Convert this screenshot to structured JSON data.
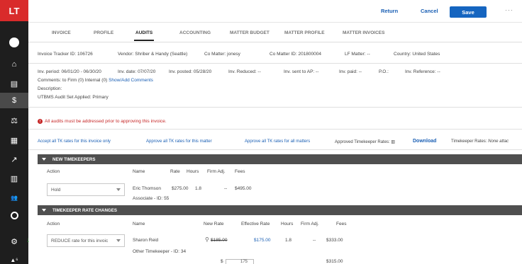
{
  "app": {
    "logo": "LT"
  },
  "nav": {
    "icons": [
      "user-avatar",
      "home-icon",
      "document-icon",
      "dollar-icon",
      "gavel-icon",
      "calendar-icon",
      "analytics-icon",
      "building-icon",
      "people-icon",
      "search-icon",
      "settings-icon",
      "alerts-icon"
    ],
    "avatar_glyph": "",
    "glyphs": {
      "home": "⌂",
      "document": "▤",
      "dollar": "$",
      "gavel": "⚖",
      "calendar": "▦",
      "analytics": "↗",
      "building": "▥",
      "people": "👥",
      "search": "○",
      "settings": "⚙",
      "alerts": "▲⁶"
    }
  },
  "toolbar": {
    "return_label": "Return",
    "cancel_label": "Cancel",
    "save_label": "Save",
    "more_label": "···"
  },
  "tabs": [
    "Invoice",
    "Profile",
    "Audits",
    "Accounting",
    "Matter Budget",
    "Matter Profile",
    "Matter Invoices"
  ],
  "active_tab": "Audits",
  "invoice_info": {
    "tracker_id": "Invoice Tracker ID: 106726",
    "vendor": "Vendor: Shriber & Handy (Seattle)",
    "co_matter": "Co Matter: jonesy",
    "co_matter_id": "Co Matter ID: 201800004",
    "lf_matter": "LF Matter: --",
    "country": "Country: United States"
  },
  "details": {
    "inv_period": "Inv. period: 06/01/20 - 06/30/20",
    "inv_date": "Inv. date: 07/07/20",
    "inv_posted": "Inv. posted: 05/28/20",
    "inv_reduced": "Inv. Reduced: --",
    "inv_sent": "Inv. sent to AP: --",
    "inv_paid": "Inv. paid: --",
    "po": "P.O.: ",
    "inv_reference": "Inv. Reference: --",
    "comments_prefix": "Comments: to Firm (0) Internal (0) ",
    "comments_link": "Show/Add Comments",
    "description": "Description:",
    "utbms": "UTBMS Audit Set Applied: Primary"
  },
  "alert_text": "All audits must be addressed prior to approving this invoice.",
  "alert_icon": "!",
  "actions": {
    "accept_invoice": "Accept all TK rates for this invoice only",
    "approve_matter": "Approve all TK rates for this matter",
    "approve_all": "Approve all TK rates for all matters",
    "approved_label": "Approved Timekeeper Rates: ▥",
    "download": "Download",
    "tk_rates": "Timekeeper Rates: ",
    "tk_rates_value": "None attac"
  },
  "new_timekeepers": {
    "title": "NEW TIMEKEEPERS",
    "headers": {
      "action": "Action",
      "name": "Name",
      "rate": "Rate",
      "hours": "Hours",
      "firm_adj": "Firm Adj.",
      "fees": "Fees"
    },
    "row": {
      "action_value": "Hold",
      "name": "Eric Thomson",
      "name_sub": "Associate - ID: 55",
      "rate": "$275.00",
      "hours": "1.8",
      "firm_adj": "--",
      "fees": "$495.00"
    }
  },
  "rate_changes": {
    "title": "TIMEKEEPER RATE CHANGES",
    "headers": {
      "action": "Action",
      "name": "Name",
      "new_rate": "New Rate",
      "effective_rate": "Effective Rate",
      "hours": "Hours",
      "firm_adj": "Firm Adj.",
      "fees": "Fees"
    },
    "row": {
      "arrow": "↓",
      "action_value": "REDUCE rate for this invoic",
      "name": "Sharon Reid",
      "name_sub": "Other Timekeeper - ID: 34",
      "search_glyph": "⚲",
      "new_rate": "$185.00",
      "effective_rate": "$175.00",
      "hours": "1.8",
      "firm_adj": "--",
      "fees": "$333.00"
    },
    "next_row": {
      "currency": "$",
      "input_value": "175",
      "fees": "$315.00"
    }
  }
}
